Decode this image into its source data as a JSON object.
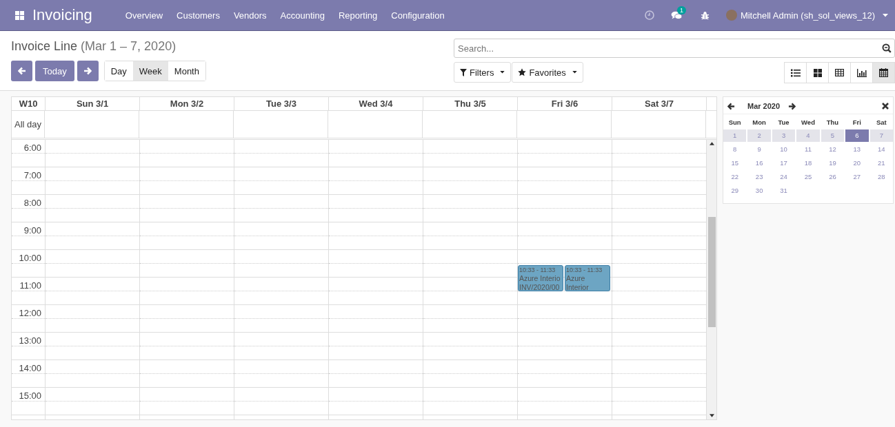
{
  "navbar": {
    "app_title": "Invoicing",
    "menu": [
      "Overview",
      "Customers",
      "Vendors",
      "Accounting",
      "Reporting",
      "Configuration"
    ],
    "chat_badge": "1",
    "user": "Mitchell Admin (sh_sol_views_12)"
  },
  "title": {
    "main": "Invoice Line",
    "range": "(Mar 1 – 7, 2020)"
  },
  "today_button": "Today",
  "scale_tabs": [
    {
      "label": "Day",
      "selected": false
    },
    {
      "label": "Week",
      "selected": true
    },
    {
      "label": "Month",
      "selected": false
    }
  ],
  "search": {
    "placeholder": "Search..."
  },
  "filters": [
    "Filters",
    "Favorites"
  ],
  "view_switcher": [
    {
      "kind": "list",
      "selected": false
    },
    {
      "kind": "kanban",
      "selected": false
    },
    {
      "kind": "pivot",
      "selected": false
    },
    {
      "kind": "graph",
      "selected": false
    },
    {
      "kind": "calendar",
      "selected": true
    }
  ],
  "week_grid": {
    "week_label": "W10",
    "all_day_label": "All day",
    "columns": [
      {
        "label": "Sun 3/1"
      },
      {
        "label": "Mon 3/2"
      },
      {
        "label": "Tue 3/3"
      },
      {
        "label": "Wed 3/4"
      },
      {
        "label": "Thu 3/5"
      },
      {
        "label": "Fri 3/6",
        "events": [
          {
            "time": "10:33 - 11:33",
            "lines": [
              "Azure Interio",
              "INV/2020/00"
            ]
          },
          {
            "time": "10:33 - 11:33",
            "lines": [
              "Azure",
              "Interior"
            ]
          }
        ]
      },
      {
        "label": "Sat 3/7"
      }
    ],
    "hours": [
      "6:00",
      "7:00",
      "8:00",
      "9:00",
      "10:00",
      "11:00",
      "12:00",
      "13:00",
      "14:00",
      "15:00"
    ]
  },
  "mini_calendar": {
    "month": "Mar 2020",
    "weekdays": [
      "Sun",
      "Mon",
      "Tue",
      "Wed",
      "Thu",
      "Fri",
      "Sat"
    ],
    "days": [
      {
        "label": "1",
        "in_week": true,
        "selected": false
      },
      {
        "label": "2",
        "in_week": true,
        "selected": false
      },
      {
        "label": "3",
        "in_week": true,
        "selected": false
      },
      {
        "label": "4",
        "in_week": true,
        "selected": false
      },
      {
        "label": "5",
        "in_week": true,
        "selected": false
      },
      {
        "label": "6",
        "in_week": true,
        "selected": true
      },
      {
        "label": "7",
        "in_week": true,
        "selected": false
      },
      {
        "label": "8",
        "in_week": false,
        "selected": false
      },
      {
        "label": "9",
        "in_week": false,
        "selected": false
      },
      {
        "label": "10",
        "in_week": false,
        "selected": false
      },
      {
        "label": "11",
        "in_week": false,
        "selected": false
      },
      {
        "label": "12",
        "in_week": false,
        "selected": false
      },
      {
        "label": "13",
        "in_week": false,
        "selected": false
      },
      {
        "label": "14",
        "in_week": false,
        "selected": false
      },
      {
        "label": "15",
        "in_week": false,
        "selected": false
      },
      {
        "label": "16",
        "in_week": false,
        "selected": false
      },
      {
        "label": "17",
        "in_week": false,
        "selected": false
      },
      {
        "label": "18",
        "in_week": false,
        "selected": false
      },
      {
        "label": "19",
        "in_week": false,
        "selected": false
      },
      {
        "label": "20",
        "in_week": false,
        "selected": false
      },
      {
        "label": "21",
        "in_week": false,
        "selected": false
      },
      {
        "label": "22",
        "in_week": false,
        "selected": false
      },
      {
        "label": "23",
        "in_week": false,
        "selected": false
      },
      {
        "label": "24",
        "in_week": false,
        "selected": false
      },
      {
        "label": "25",
        "in_week": false,
        "selected": false
      },
      {
        "label": "26",
        "in_week": false,
        "selected": false
      },
      {
        "label": "27",
        "in_week": false,
        "selected": false
      },
      {
        "label": "28",
        "in_week": false,
        "selected": false
      },
      {
        "label": "29",
        "in_week": false,
        "selected": false
      },
      {
        "label": "30",
        "in_week": false,
        "selected": false
      },
      {
        "label": "31",
        "in_week": false,
        "selected": false
      }
    ]
  }
}
